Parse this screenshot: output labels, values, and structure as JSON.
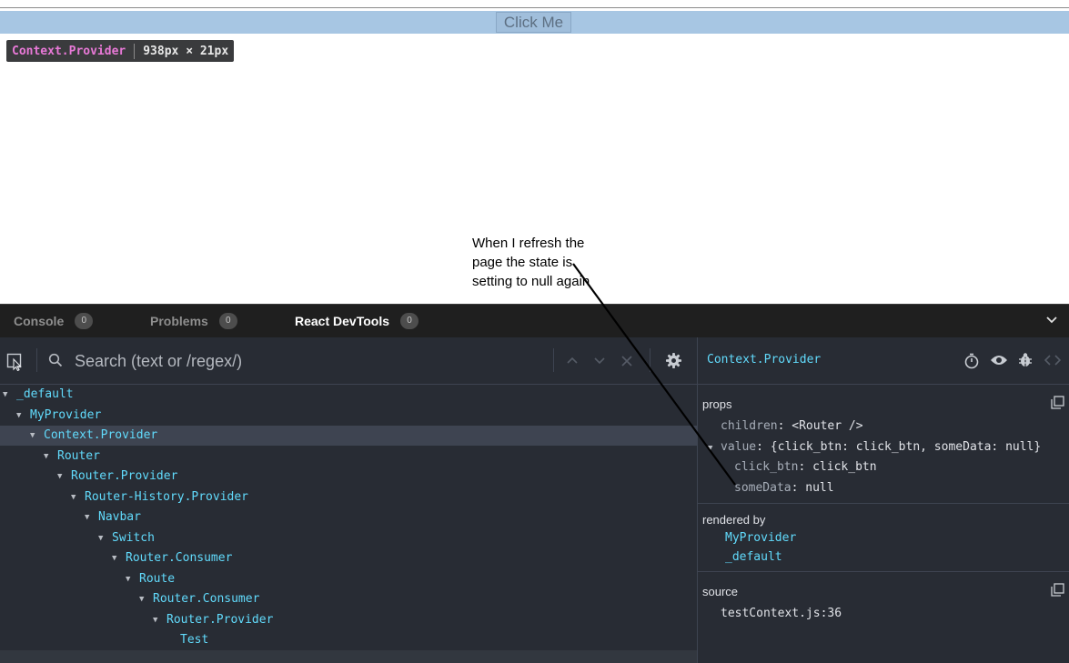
{
  "page": {
    "button_label": "Click Me",
    "tooltip": {
      "component": "Context.Provider",
      "size": "938px × 21px"
    },
    "annotation": [
      "When I refresh the",
      "page the state is",
      "setting to null again"
    ]
  },
  "panel": {
    "tabs": [
      {
        "label": "Console",
        "count": "0"
      },
      {
        "label": "Problems",
        "count": "0"
      },
      {
        "label": "React DevTools",
        "count": "0"
      }
    ]
  },
  "devtools": {
    "search_placeholder": "Search (text or /regex/)",
    "tree": [
      {
        "name": "_default",
        "expanded": true
      },
      {
        "name": "MyProvider",
        "expanded": true
      },
      {
        "name": "Context.Provider",
        "expanded": true,
        "selected": true
      },
      {
        "name": "Router",
        "expanded": true
      },
      {
        "name": "Router.Provider",
        "expanded": true
      },
      {
        "name": "Router-History.Provider",
        "expanded": true
      },
      {
        "name": "Navbar",
        "expanded": true
      },
      {
        "name": "Switch",
        "expanded": true
      },
      {
        "name": "Router.Consumer",
        "expanded": true
      },
      {
        "name": "Route",
        "expanded": true
      },
      {
        "name": "Router.Consumer",
        "expanded": true
      },
      {
        "name": "Router.Provider",
        "expanded": true
      },
      {
        "name": "Test",
        "expanded": false
      }
    ],
    "selected_component": "Context.Provider",
    "props_label": "props",
    "props": {
      "children_key": "children",
      "children_value": "<Router />",
      "value_key": "value",
      "value_summary": "{click_btn: click_btn, someData: null}",
      "click_btn_key": "click_btn",
      "click_btn_value": "click_btn",
      "someData_key": "someData",
      "someData_value": "null"
    },
    "rendered_by_label": "rendered by",
    "rendered_by": [
      "MyProvider",
      "_default"
    ],
    "source_label": "source",
    "source": "testContext.js:36"
  },
  "colors": {
    "accent": "#61dafb",
    "tooltip_name": "#e879d7",
    "pane_bg": "#282c34"
  }
}
